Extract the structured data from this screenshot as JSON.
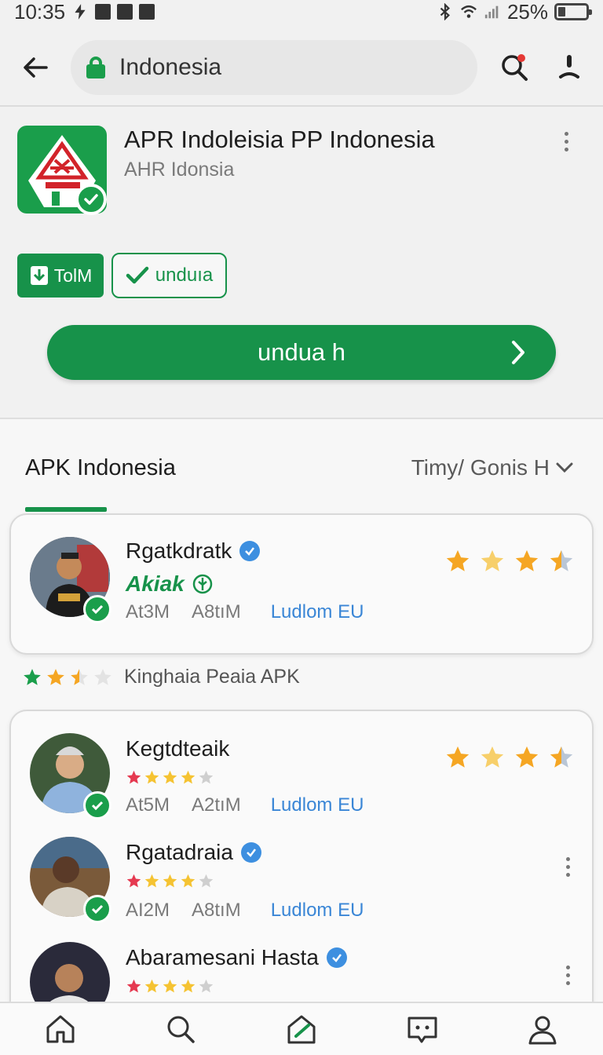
{
  "status_bar": {
    "time": "10:35",
    "battery": "25%",
    "battery_level": 0.25
  },
  "search": {
    "value": "Indonesia"
  },
  "app": {
    "title": "APR Indoleisia PP Indonesia",
    "subtitle": "AHR Idonsia",
    "btn_small_label": "TolM",
    "btn_outline_label": "unduıa",
    "btn_main_label": "undua h"
  },
  "section": {
    "tab_label": "APK Indonesia",
    "sort_label": "Timy/ Gonis H"
  },
  "cards": [
    {
      "name": "Rgatkdratk",
      "tag": "Akiak",
      "meta1": "At3M",
      "meta2": "A8tıM",
      "link": "Ludlom EU",
      "rating": 3.5
    }
  ],
  "rating_row": {
    "label": "Kinghaia Peaia APK",
    "rating": 2.5
  },
  "list": [
    {
      "name": "Kegtdteaik",
      "meta1": "At5M",
      "meta2": "A2tıM",
      "link": "Ludlom EU",
      "rating": 3.5,
      "mini_rating": 4
    },
    {
      "name": "Rgatadraia",
      "meta1": "AI2M",
      "meta2": "A8tıM",
      "link": "Ludlom EU",
      "mini_rating": 4
    },
    {
      "name": "Abaramesani Hasta",
      "mini_rating": 4
    }
  ],
  "colors": {
    "brand_green": "#17924a",
    "link_blue": "#3a86d6",
    "star_gold": "#f5a623"
  },
  "icons": {
    "back": "back-arrow-icon",
    "lock": "lock-icon",
    "search": "search-icon",
    "account": "account-icon",
    "nav": [
      "home-icon",
      "search-icon",
      "store-icon",
      "chat-icon",
      "profile-icon"
    ]
  }
}
